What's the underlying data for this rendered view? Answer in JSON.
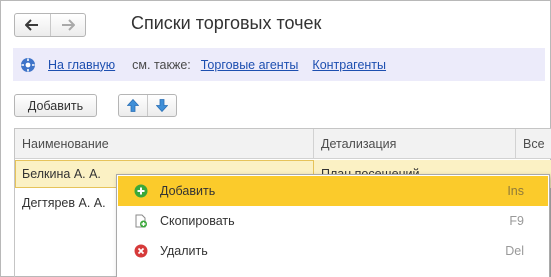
{
  "window": {
    "title": "Списки торговых точек"
  },
  "nav": {
    "back_icon": "arrow-left-icon",
    "forward_icon": "arrow-right-icon"
  },
  "links_bar": {
    "home_link": "На главную",
    "see_also": "см. также:",
    "links": [
      "Торговые агенты",
      "Контрагенты"
    ],
    "background": "#ecebfa",
    "link_color": "#1d4fb0"
  },
  "toolbar": {
    "add_label": "Добавить",
    "move_up_icon": "arrow-up-icon",
    "move_down_icon": "arrow-down-icon"
  },
  "table": {
    "columns": [
      "Наименование",
      "Детализация",
      "Все"
    ],
    "rows": [
      [
        "Белкина А. А.",
        "План посещений",
        ""
      ],
      [
        "Дегтярев А. А.",
        "",
        ""
      ]
    ],
    "selected_row_color": "#fbf1c4"
  },
  "context_menu": {
    "items": [
      {
        "label": "Добавить",
        "shortcut": "Ins",
        "icon": "add-green-icon"
      },
      {
        "label": "Скопировать",
        "shortcut": "F9",
        "icon": "copy-icon"
      },
      {
        "label": "Удалить",
        "shortcut": "Del",
        "icon": "delete-red-icon"
      }
    ],
    "highlight_color": "#fbcb2b"
  }
}
